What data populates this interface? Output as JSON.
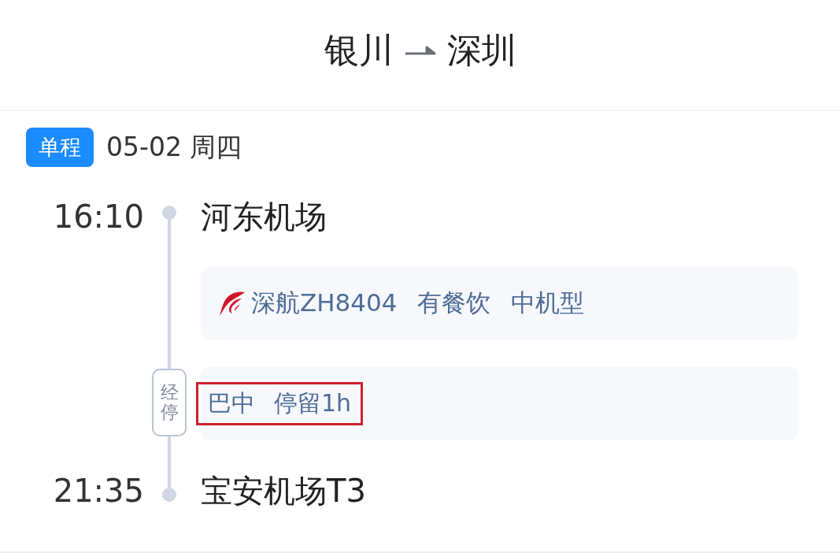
{
  "header": {
    "origin": "银川",
    "destination": "深圳"
  },
  "trip": {
    "badge": "单程",
    "date": "05-02 周四"
  },
  "departure": {
    "time": "16:10",
    "airport": "河东机场"
  },
  "flight": {
    "airline_flight": "深航ZH8404",
    "meal": "有餐饮",
    "aircraft": "中机型"
  },
  "stop": {
    "label": "经停",
    "city": "巴中",
    "duration": "停留1h",
    "highlighted": true
  },
  "arrival": {
    "time": "21:35",
    "airport": "宝安机场T3"
  }
}
